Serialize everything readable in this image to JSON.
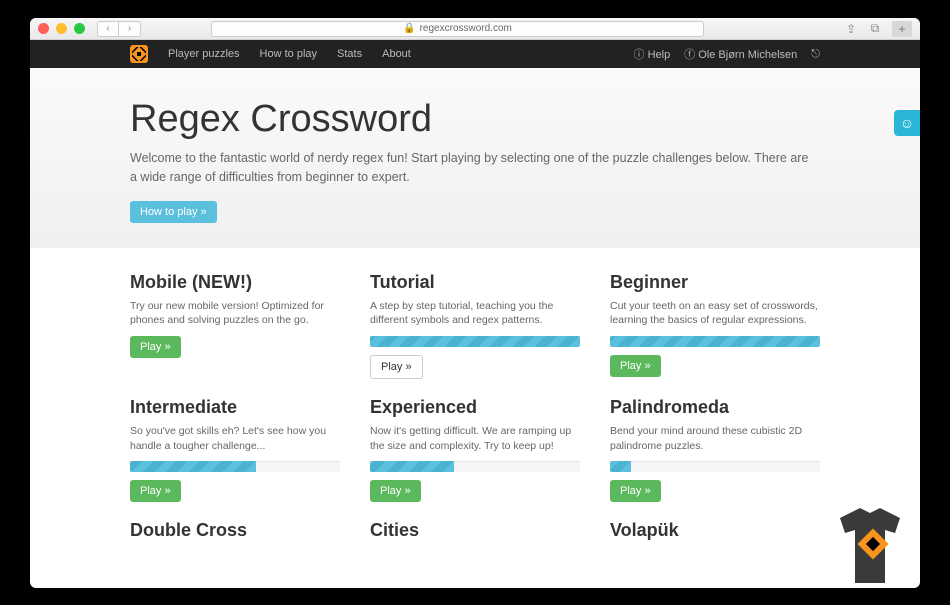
{
  "browser": {
    "url_host": "regexcrossword.com",
    "lock_icon": "🔒"
  },
  "nav": {
    "links": [
      "Player puzzles",
      "How to play",
      "Stats",
      "About"
    ],
    "help": "Help",
    "user": "Ole Bjørn Michelsen"
  },
  "hero": {
    "title": "Regex Crossword",
    "subtitle": "Welcome to the fantastic world of nerdy regex fun! Start playing by selecting one of the puzzle challenges below. There are a wide range of difficulties from beginner to expert.",
    "cta": "How to play »"
  },
  "play_label": "Play »",
  "cards": [
    {
      "title": "Mobile (NEW!)",
      "desc": "Try our new mobile version! Optimized for phones and solving puzzles on the go.",
      "progress": null,
      "btn": "green"
    },
    {
      "title": "Tutorial",
      "desc": "A step by step tutorial, teaching you the different symbols and regex patterns.",
      "progress": 100,
      "btn": "default"
    },
    {
      "title": "Beginner",
      "desc": "Cut your teeth on an easy set of crosswords, learning the basics of regular expressions.",
      "progress": 100,
      "btn": "green"
    },
    {
      "title": "Intermediate",
      "desc": "So you've got skills eh? Let's see how you handle a tougher challenge...",
      "progress": 60,
      "btn": "green"
    },
    {
      "title": "Experienced",
      "desc": "Now it's getting difficult. We are ramping up the size and complexity. Try to keep up!",
      "progress": 40,
      "btn": "green"
    },
    {
      "title": "Palindromeda",
      "desc": "Bend your mind around these cubistic 2D palindrome puzzles.",
      "progress": 10,
      "btn": "green"
    },
    {
      "title": "Double Cross",
      "desc": "",
      "progress": null,
      "btn": null
    },
    {
      "title": "Cities",
      "desc": "",
      "progress": null,
      "btn": null
    },
    {
      "title": "Volapük",
      "desc": "",
      "progress": null,
      "btn": null
    }
  ]
}
